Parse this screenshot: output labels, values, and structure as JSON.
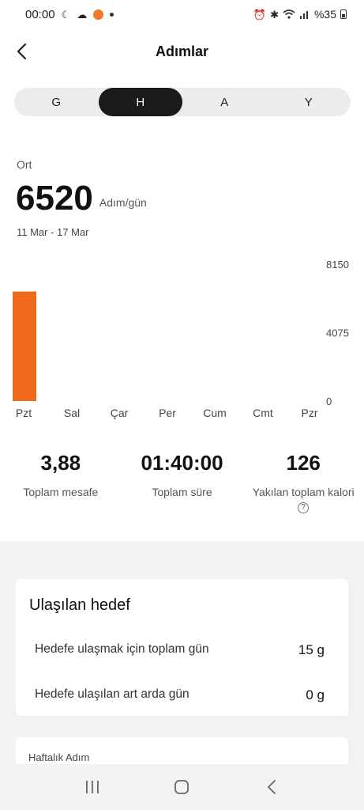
{
  "status_bar": {
    "time": "00:00",
    "battery_text": "%35"
  },
  "header": {
    "title": "Adımlar",
    "back_icon": "chevron-left-icon"
  },
  "period_tabs": [
    {
      "label": "G",
      "active": false
    },
    {
      "label": "H",
      "active": true
    },
    {
      "label": "A",
      "active": false
    },
    {
      "label": "Y",
      "active": false
    }
  ],
  "summary": {
    "avg_label": "Ort",
    "avg_value": "6520",
    "unit": "Adım/gün",
    "date_range": "11 Mar - 17 Mar"
  },
  "chart_data": {
    "type": "bar",
    "categories": [
      "Pzt",
      "Sal",
      "Çar",
      "Per",
      "Cum",
      "Cmt",
      "Pzr"
    ],
    "values": [
      6520,
      0,
      0,
      0,
      0,
      0,
      0
    ],
    "ylim": [
      0,
      8150
    ],
    "y_ticks": [
      "8150",
      "4075",
      "0"
    ],
    "y_tick_values": [
      8150,
      4075,
      0
    ],
    "bar_color": "#f26a1b",
    "y_axis_position": "right",
    "grid": false
  },
  "stats": [
    {
      "value": "3,88",
      "label": "Toplam mesafe"
    },
    {
      "value": "01:40:00",
      "label": "Toplam süre"
    },
    {
      "value": "126",
      "label": "Yakılan toplam kalori",
      "info_icon": "info-icon"
    }
  ],
  "goal_card": {
    "title": "Ulaşılan hedef",
    "rows": [
      {
        "label": "Hedefe ulaşmak için toplam gün",
        "value": "15 g"
      },
      {
        "label": "Hedefe ulaşılan art arda gün",
        "value": "0 g"
      }
    ]
  },
  "weekly_card": {
    "title": "Haftalık Adım"
  },
  "nav_bar": {
    "icons": [
      "recent-apps-icon",
      "home-icon",
      "back-icon"
    ]
  }
}
